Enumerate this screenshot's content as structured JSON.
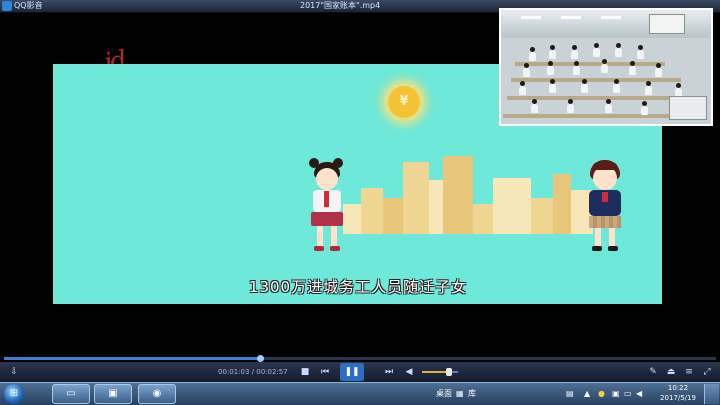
{
  "window": {
    "app_name": "QQ影音",
    "file_title": "2017\"国家账本\".mp4"
  },
  "video": {
    "watermark": "jd",
    "sun_symbol": "¥",
    "caption": "1300万进城务工人员随迁子女"
  },
  "player": {
    "time_current": "00:01:03",
    "time_separator": " / ",
    "time_total": "00:02:57",
    "progress": 0.36,
    "volume": 0.75,
    "play_state_icon": "pause-icon"
  },
  "taskbar": {
    "desktop_label": "桌面",
    "library_label": "库",
    "clock_time": "10:22",
    "clock_date": "2017/5/19"
  },
  "colors": {
    "video_background": "#6ee8d8",
    "accent": "#2c6ec4",
    "caption_text": "#ffffff",
    "watermark": "#b0282a"
  }
}
